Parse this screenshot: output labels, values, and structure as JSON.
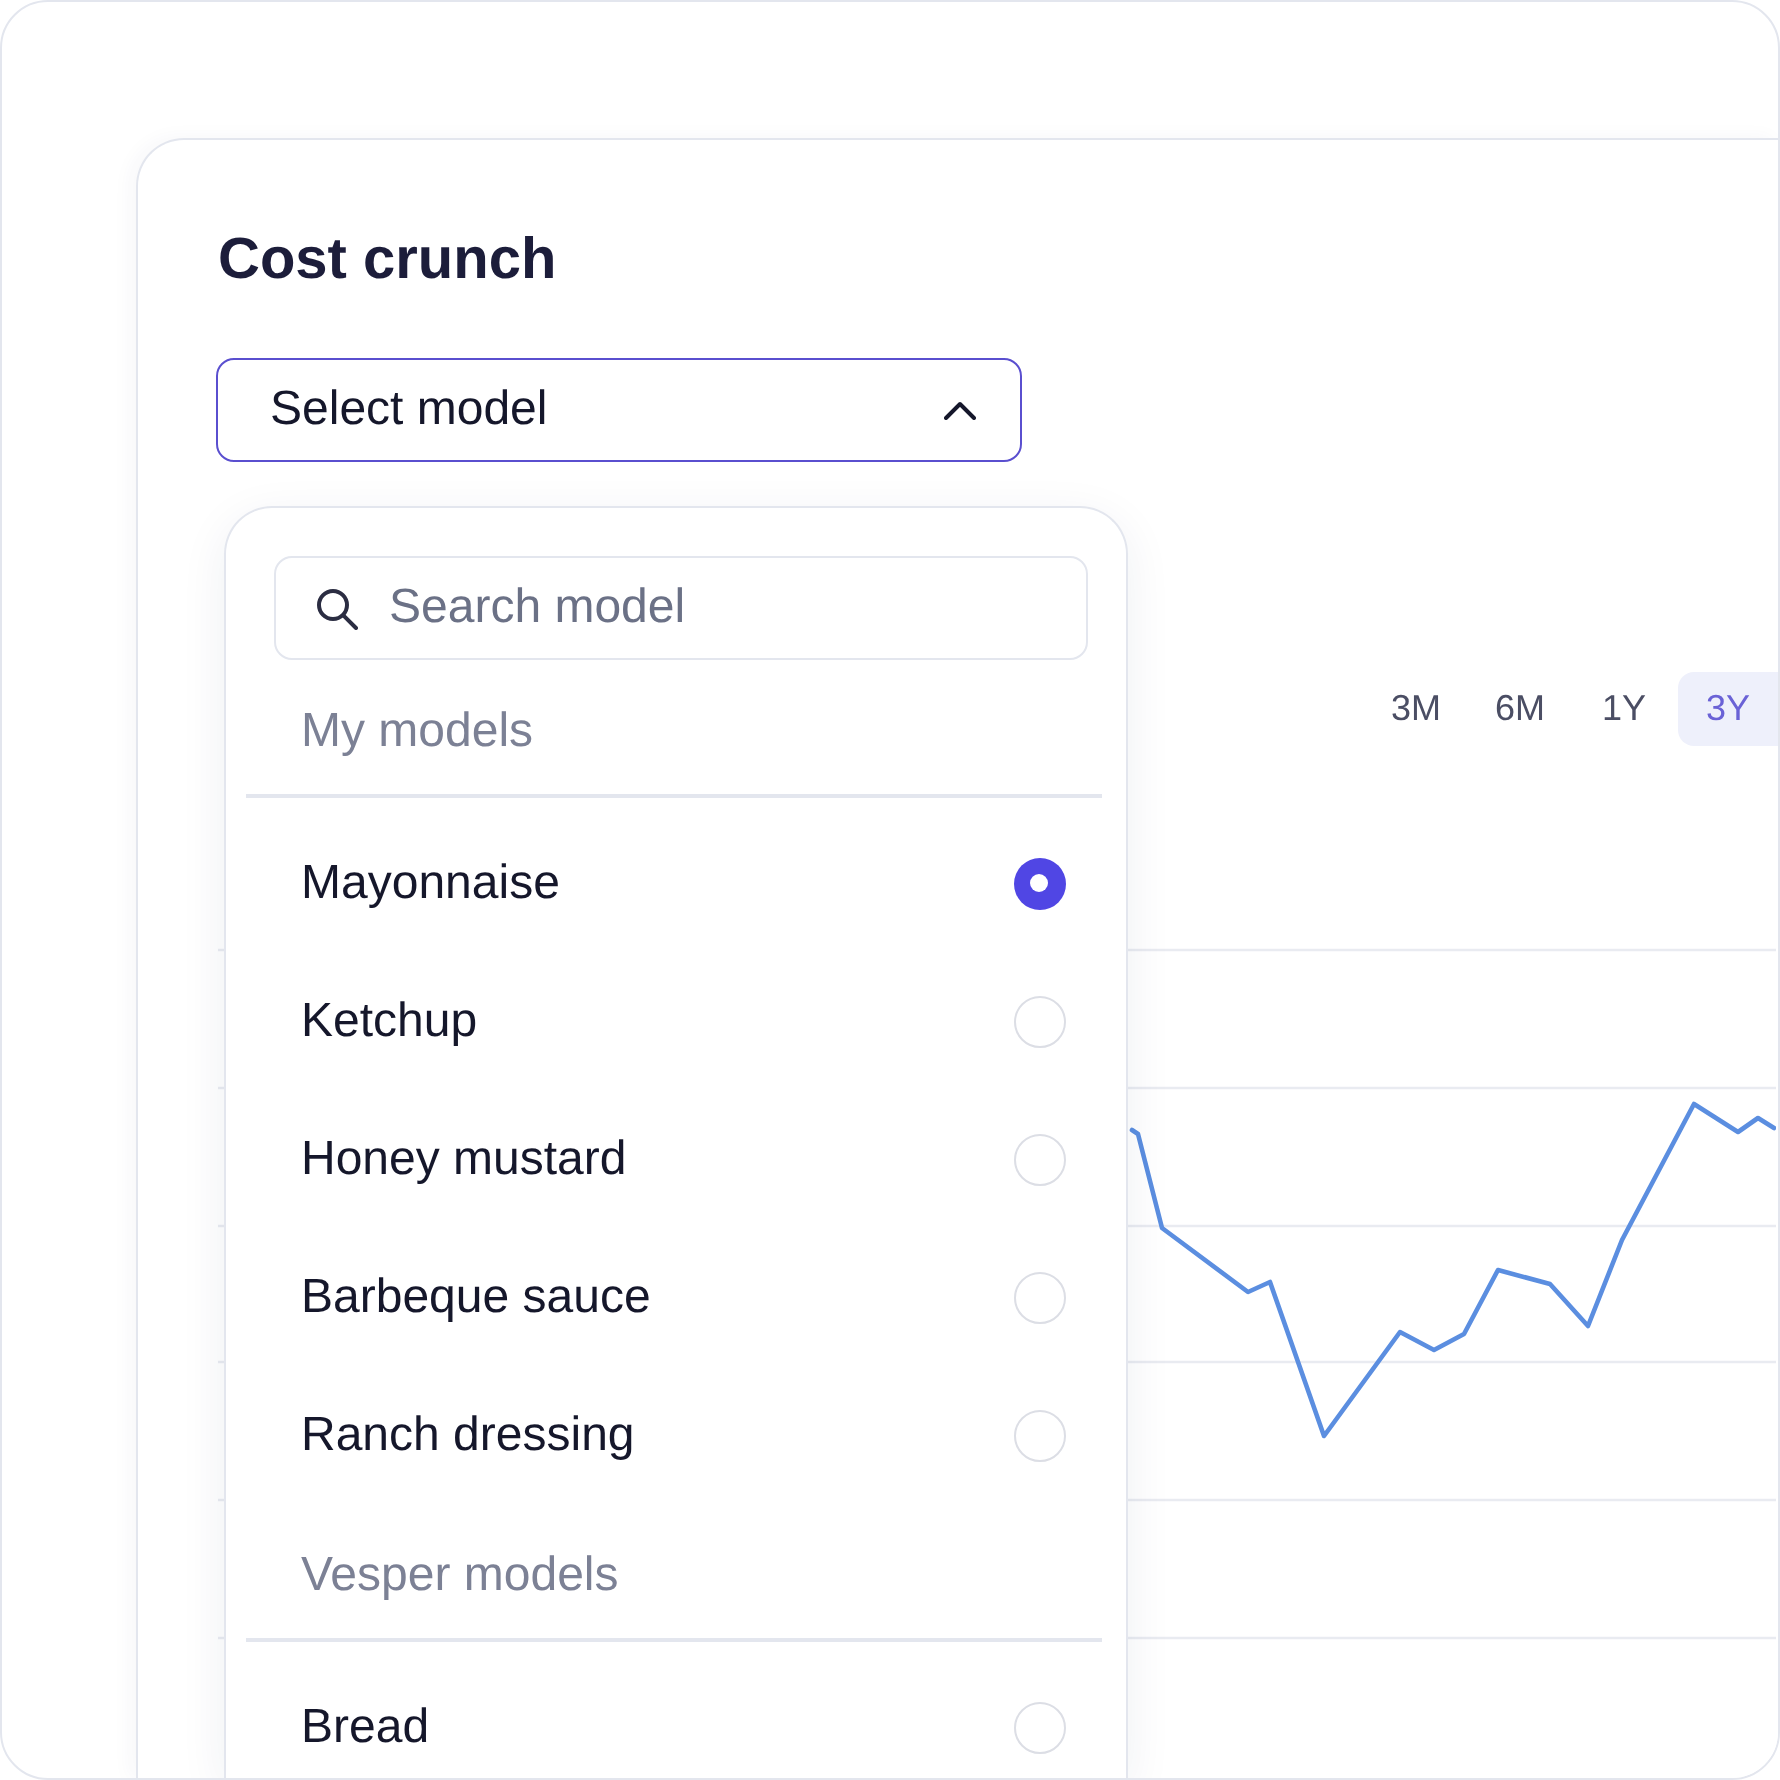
{
  "card": {
    "title": "Cost crunch",
    "model_select": {
      "label": "Select model",
      "expanded": true,
      "search": {
        "placeholder": "Search model"
      },
      "groups": [
        {
          "heading": "My models",
          "options": [
            {
              "label": "Mayonnaise",
              "selected": true
            },
            {
              "label": "Ketchup",
              "selected": false
            },
            {
              "label": "Honey mustard",
              "selected": false
            },
            {
              "label": "Barbeque sauce",
              "selected": false
            },
            {
              "label": "Ranch dressing",
              "selected": false
            }
          ]
        },
        {
          "heading": "Vesper models",
          "options": [
            {
              "label": "Bread",
              "selected": false
            }
          ]
        }
      ]
    },
    "range_tabs": [
      {
        "label": "3M",
        "selected": false
      },
      {
        "label": "6M",
        "selected": false
      },
      {
        "label": "1Y",
        "selected": false
      },
      {
        "label": "3Y",
        "selected": true
      }
    ]
  }
}
